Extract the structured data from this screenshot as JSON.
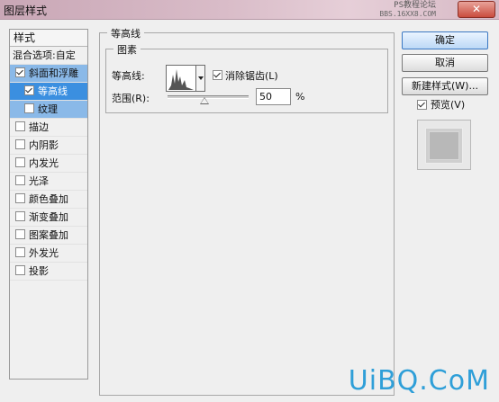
{
  "window": {
    "title": "图层样式",
    "close_label": "✕"
  },
  "watermark": {
    "line1": "PS教程论坛",
    "line2": "BBS.16XX8.COM"
  },
  "style_list": {
    "header": "样式",
    "items": [
      {
        "label": "混合选项:自定",
        "checked": null
      },
      {
        "label": "斜面和浮雕",
        "checked": true
      },
      {
        "label": "等高线",
        "checked": true
      },
      {
        "label": "纹理",
        "checked": false
      },
      {
        "label": "描边",
        "checked": false
      },
      {
        "label": "内阴影",
        "checked": false
      },
      {
        "label": "内发光",
        "checked": false
      },
      {
        "label": "光泽",
        "checked": false
      },
      {
        "label": "颜色叠加",
        "checked": false
      },
      {
        "label": "渐变叠加",
        "checked": false
      },
      {
        "label": "图案叠加",
        "checked": false
      },
      {
        "label": "外发光",
        "checked": false
      },
      {
        "label": "投影",
        "checked": false
      }
    ]
  },
  "panel": {
    "group_title": "等高线",
    "subgroup_title": "图素",
    "contour_label": "等高线:",
    "anti_alias_label": "消除锯齿(L)",
    "anti_alias_checked": true,
    "range_label": "范围(R):",
    "range_value": "50",
    "range_unit": "%"
  },
  "buttons": {
    "ok": "确定",
    "cancel": "取消",
    "new_style": "新建样式(W)...",
    "preview_label": "预览(V)",
    "preview_checked": true
  },
  "brand": "UiBQ.CoM",
  "colors": {
    "selected": "#3b8fe0",
    "selected_parent": "#8ab9e8",
    "brand": "#2f9fd8"
  }
}
